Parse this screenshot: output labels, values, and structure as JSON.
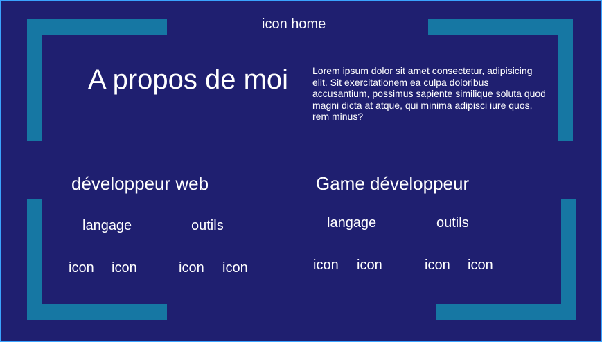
{
  "header": {
    "home_label": "icon home"
  },
  "about": {
    "title": "A propos de moi",
    "text": "Lorem ipsum dolor sit amet consectetur, adipisicing elit. Sit exercitationem ea culpa doloribus accusantium, possimus sapiente similique soluta quod magni dicta at atque, qui minima adipisci iure quos, rem minus?"
  },
  "web_dev": {
    "title": "développeur web",
    "languages_label": "langage",
    "tools_label": "outils",
    "language_icons": [
      "icon",
      "icon"
    ],
    "tool_icons": [
      "icon",
      "icon"
    ]
  },
  "game_dev": {
    "title": "Game développeur",
    "languages_label": "langage",
    "tools_label": "outils",
    "language_icons": [
      "icon",
      "icon"
    ],
    "tool_icons": [
      "icon",
      "icon"
    ]
  },
  "colors": {
    "background": "#1f1f70",
    "accent_bar": "#1677a3",
    "border": "#3aa3ff",
    "text": "#ffffff"
  }
}
